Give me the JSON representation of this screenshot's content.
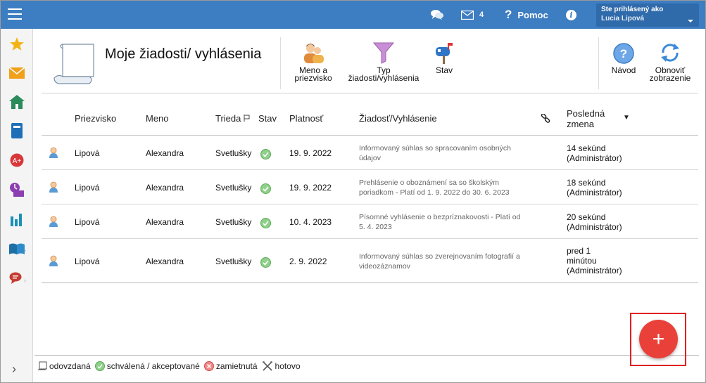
{
  "topbar": {
    "mail_count": "4",
    "help_label": "Pomoc",
    "user_label": "Ste prihlásený ako",
    "user_name": "Lucia Lipová"
  },
  "header": {
    "title": "Moje žiadosti/ vyhlásenia",
    "tools": {
      "name_line1": "Meno a",
      "name_line2": "priezvisko",
      "type_line1": "Typ",
      "type_line2": "žiadosti/vyhlásenia",
      "status": "Stav",
      "guide": "Návod",
      "refresh_line1": "Obnoviť",
      "refresh_line2": "zobrazenie"
    }
  },
  "table": {
    "columns": {
      "surname": "Priezvisko",
      "name": "Meno",
      "class": "Trieda",
      "status": "Stav",
      "validity": "Platnosť",
      "request": "Žiadosť/Vyhlásenie",
      "last_change_line1": "Posledná",
      "last_change_line2": "zmena"
    },
    "rows": [
      {
        "surname": "Lipová",
        "name": "Alexandra",
        "class": "Svetlušky",
        "validity": "19. 9. 2022",
        "req1": "Informovaný súhlas so spracovaním osobných",
        "req2": "údajov",
        "chg1": "14 sekúnd",
        "chg2": "(Administrátor)",
        "chg3": ""
      },
      {
        "surname": "Lipová",
        "name": "Alexandra",
        "class": "Svetlušky",
        "validity": "19. 9. 2022",
        "req1": "Prehlásenie o oboznámení sa so školským",
        "req2": "poriadkom - Platí od 1. 9. 2022 do 30. 6. 2023",
        "chg1": "18 sekúnd",
        "chg2": "(Administrátor)",
        "chg3": ""
      },
      {
        "surname": "Lipová",
        "name": "Alexandra",
        "class": "Svetlušky",
        "validity": "10. 4. 2023",
        "req1": "Písomné vyhlásenie o bezpríznakovosti - Platí od",
        "req2": "5. 4. 2023",
        "chg1": "20 sekúnd",
        "chg2": "(Administrátor)",
        "chg3": ""
      },
      {
        "surname": "Lipová",
        "name": "Alexandra",
        "class": "Svetlušky",
        "validity": "2. 9. 2022",
        "req1": "Informovaný súhlas so zverejnovaním fotografií a",
        "req2": "videozáznamov",
        "chg1": "pred 1",
        "chg2": "minútou",
        "chg3": "(Administrátor)"
      }
    ]
  },
  "legend": {
    "submitted": "odovzdaná",
    "approved": "schválená / akceptované",
    "rejected": "zamietnutá",
    "done": "hotovo"
  },
  "fab": {
    "label": "+"
  },
  "colors": {
    "topbar": "#3d7dc1",
    "fab": "#e9413a",
    "highlight": "#e02020"
  }
}
